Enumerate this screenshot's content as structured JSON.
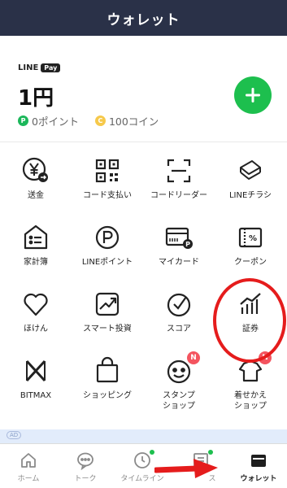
{
  "header": {
    "title": "ウォレット"
  },
  "pay": {
    "brand_line": "LINE",
    "brand_pay": "Pay",
    "balance": "1円",
    "points_icon": "P",
    "points": "0ポイント",
    "coins_icon": "C",
    "coins": "100コイン"
  },
  "services": [
    {
      "label": "送金",
      "icon": "yen-send-icon"
    },
    {
      "label": "コード支払い",
      "icon": "qr-code-icon"
    },
    {
      "label": "コードリーダー",
      "icon": "code-reader-icon"
    },
    {
      "label": "LINEチラシ",
      "icon": "flyer-icon"
    },
    {
      "label": "家計簿",
      "icon": "household-book-icon"
    },
    {
      "label": "LINEポイント",
      "icon": "point-icon"
    },
    {
      "label": "マイカード",
      "icon": "my-card-icon"
    },
    {
      "label": "クーポン",
      "icon": "coupon-icon"
    },
    {
      "label": "ほけん",
      "icon": "heart-icon"
    },
    {
      "label": "スマート投資",
      "icon": "smart-invest-icon"
    },
    {
      "label": "スコア",
      "icon": "score-icon"
    },
    {
      "label": "証券",
      "icon": "securities-chart-icon"
    },
    {
      "label": "BITMAX",
      "icon": "bitmax-icon"
    },
    {
      "label": "ショッピング",
      "icon": "shopping-bag-icon"
    },
    {
      "label": "スタンプ\nショップ",
      "icon": "sticker-shop-icon",
      "badge": "N"
    },
    {
      "label": "着せかえ\nショップ",
      "icon": "theme-shop-icon",
      "badge": "N"
    }
  ],
  "ad_label": "AD",
  "tabs": [
    {
      "label": "ホーム",
      "icon": "home-icon"
    },
    {
      "label": "トーク",
      "icon": "chat-icon"
    },
    {
      "label": "タイムライン",
      "icon": "clock-icon"
    },
    {
      "label": "ス",
      "icon": "news-icon"
    },
    {
      "label": "ウォレット",
      "icon": "wallet-icon"
    }
  ],
  "colors": {
    "header_bg": "#2a3148",
    "accent_green": "#1dbf4e",
    "annotation_red": "#e51c1c",
    "badge_red": "#f4545f"
  }
}
